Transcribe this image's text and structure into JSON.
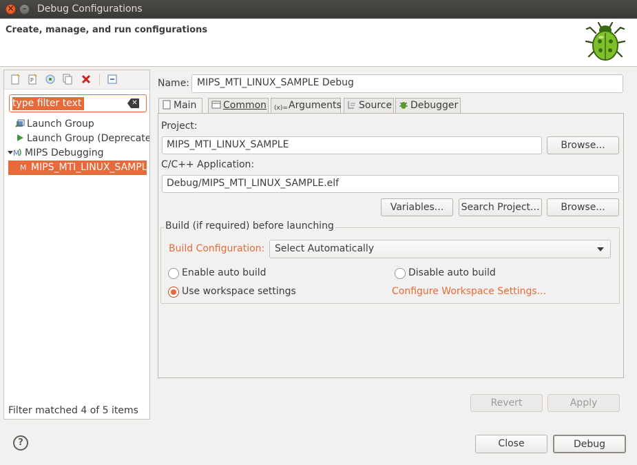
{
  "window": {
    "title": "Debug Configurations",
    "close_glyph": "×",
    "min_glyph": "–"
  },
  "header": {
    "subtitle": "Create, manage, and run configurations"
  },
  "left": {
    "filter_placeholder": "type filter text",
    "tree": [
      {
        "label": "Launch Group",
        "icon": "launch-group-icon"
      },
      {
        "label": "Launch Group (Deprecated)",
        "icon": "launch-group-deprecated-icon"
      },
      {
        "label": "MIPS Debugging",
        "icon": "mips-debug-icon"
      },
      {
        "label": "MIPS_MTI_LINUX_SAMPLE Debug",
        "icon": "mips-config-icon"
      }
    ],
    "status": "Filter matched 4 of 5 items"
  },
  "name": {
    "label": "Name:",
    "value": "MIPS_MTI_LINUX_SAMPLE Debug"
  },
  "tabs": [
    "Main",
    "Common",
    "Arguments",
    "Source",
    "Debugger"
  ],
  "main": {
    "project_label": "Project:",
    "project_value": "MIPS_MTI_LINUX_SAMPLE",
    "browse_label": "Browse...",
    "app_label": "C/C++ Application:",
    "app_value": "Debug/MIPS_MTI_LINUX_SAMPLE.elf",
    "variables_label": "Variables...",
    "search_project_label": "Search Project...",
    "browse2_label": "Browse...",
    "build_group_title": "Build (if required) before launching",
    "build_config_label": "Build Configuration:",
    "build_config_value": "Select Automatically",
    "enable_auto_build": "Enable auto build",
    "disable_auto_build": "Disable auto build",
    "use_workspace": "Use workspace settings",
    "configure_workspace": "Configure Workspace Settings..."
  },
  "actions": {
    "revert": "Revert",
    "apply": "Apply",
    "close": "Close",
    "debug": "Debug"
  },
  "colors": {
    "accent": "#e66a3a",
    "titlebar": "#3b3a36"
  }
}
